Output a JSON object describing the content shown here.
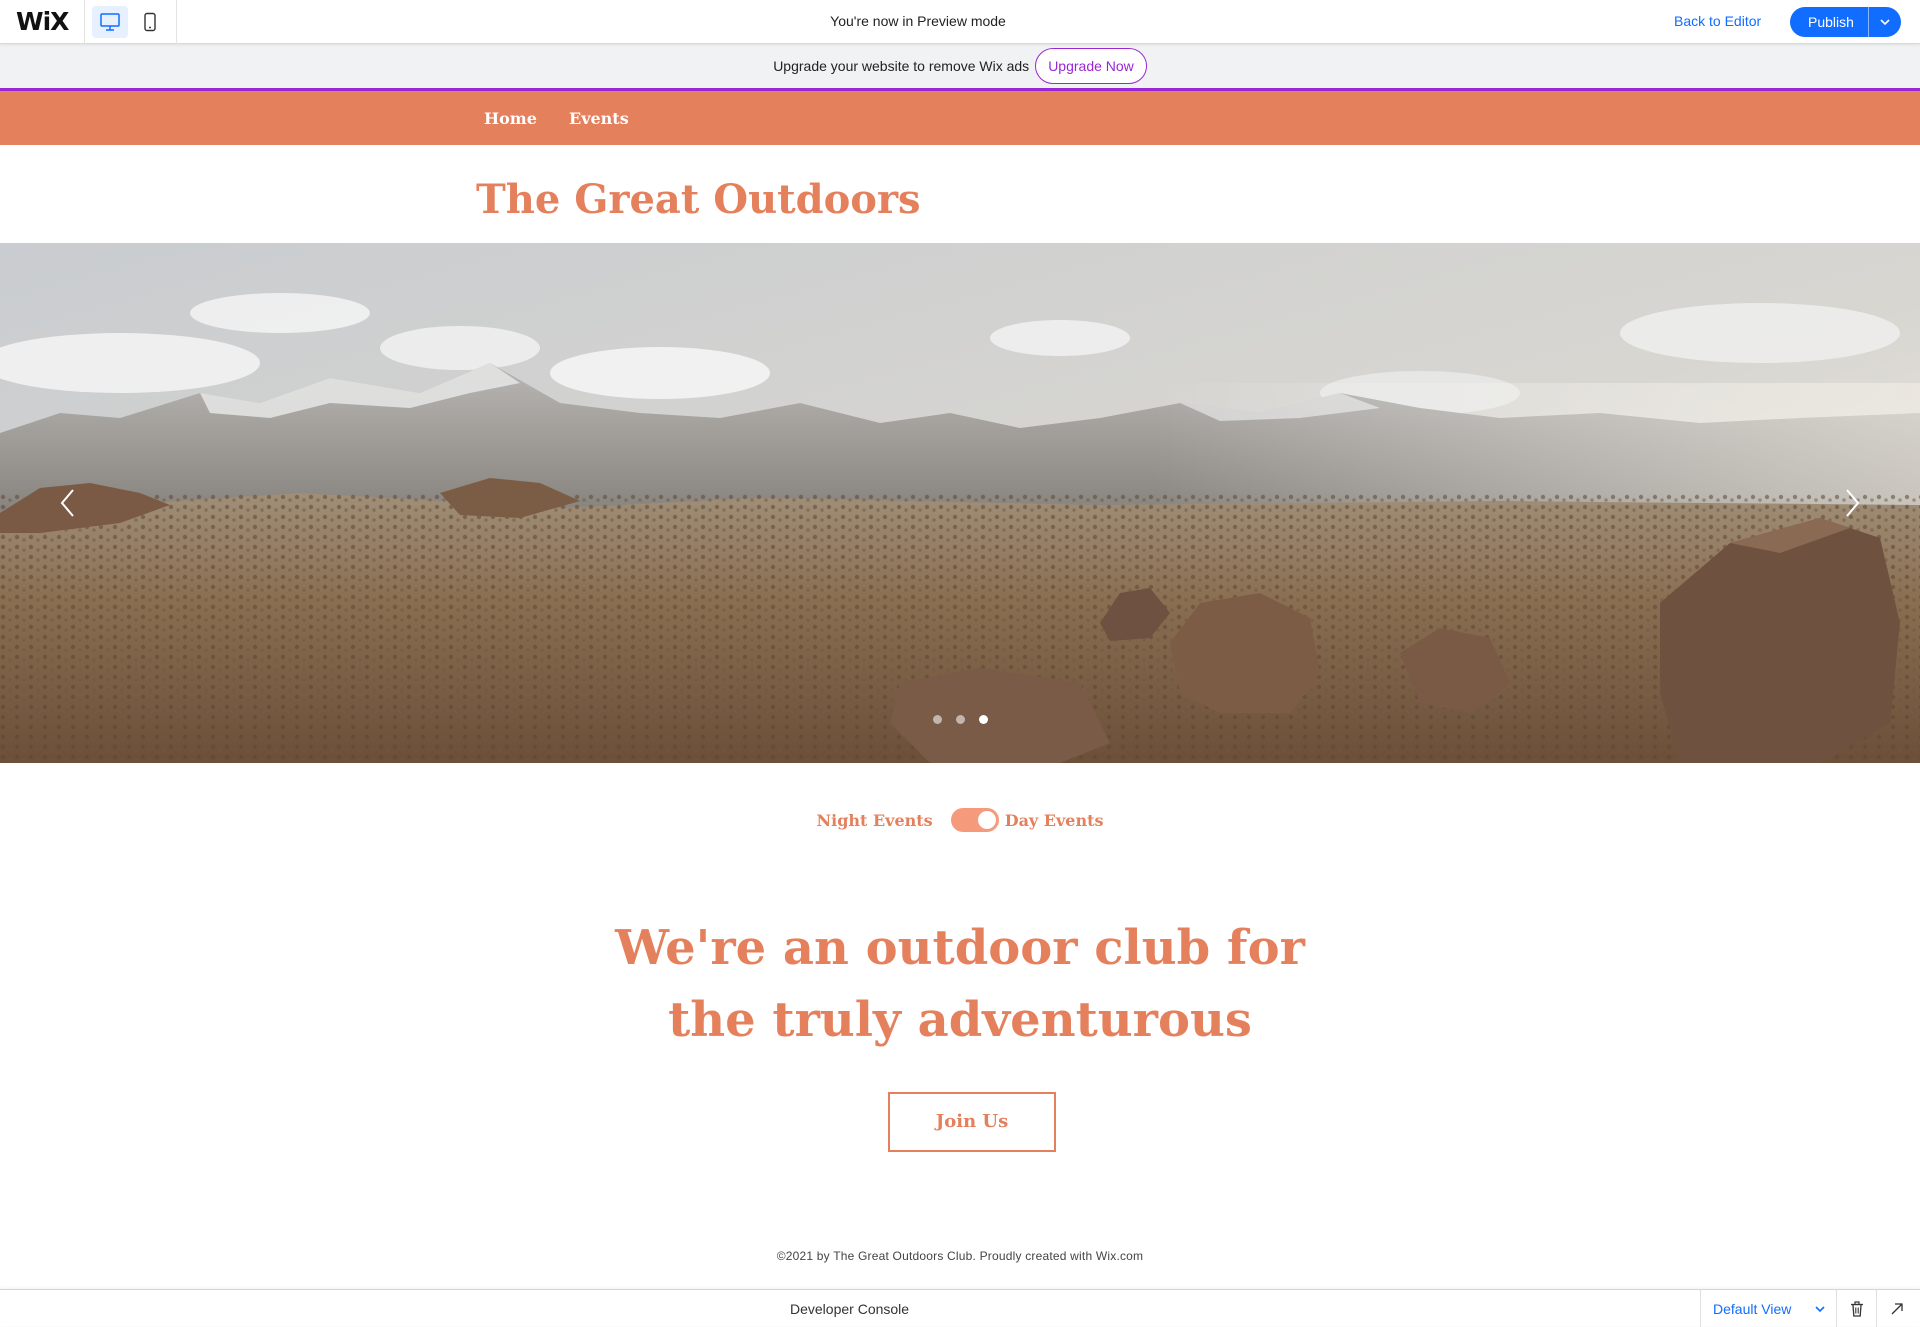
{
  "topbar": {
    "logo": "WiX",
    "preview_text": "You're now in Preview mode",
    "back_to_editor": "Back to Editor",
    "publish": "Publish"
  },
  "upgrade": {
    "message": "Upgrade your website to remove Wix ads",
    "button": "Upgrade Now"
  },
  "site": {
    "nav": [
      {
        "label": "Home"
      },
      {
        "label": "Events"
      }
    ],
    "title": "The Great Outdoors",
    "slideshow": {
      "slide_count": 3,
      "active_slide": 3
    },
    "toggle": {
      "left_label": "Night Events",
      "right_label": "Day Events",
      "state": "on"
    },
    "headline_line1": "We're an outdoor club for",
    "headline_line2": "the truly adventurous",
    "join_button": "Join Us",
    "footer": "©2021 by The Great Outdoors Club. Proudly created with Wix.com"
  },
  "dev_console": {
    "title": "Developer Console",
    "view_select": "Default View"
  },
  "colors": {
    "accent": "#e5805d",
    "toggle": "#f59b7c",
    "wix_blue": "#116dff",
    "upgrade_purple": "#9a27d5"
  }
}
